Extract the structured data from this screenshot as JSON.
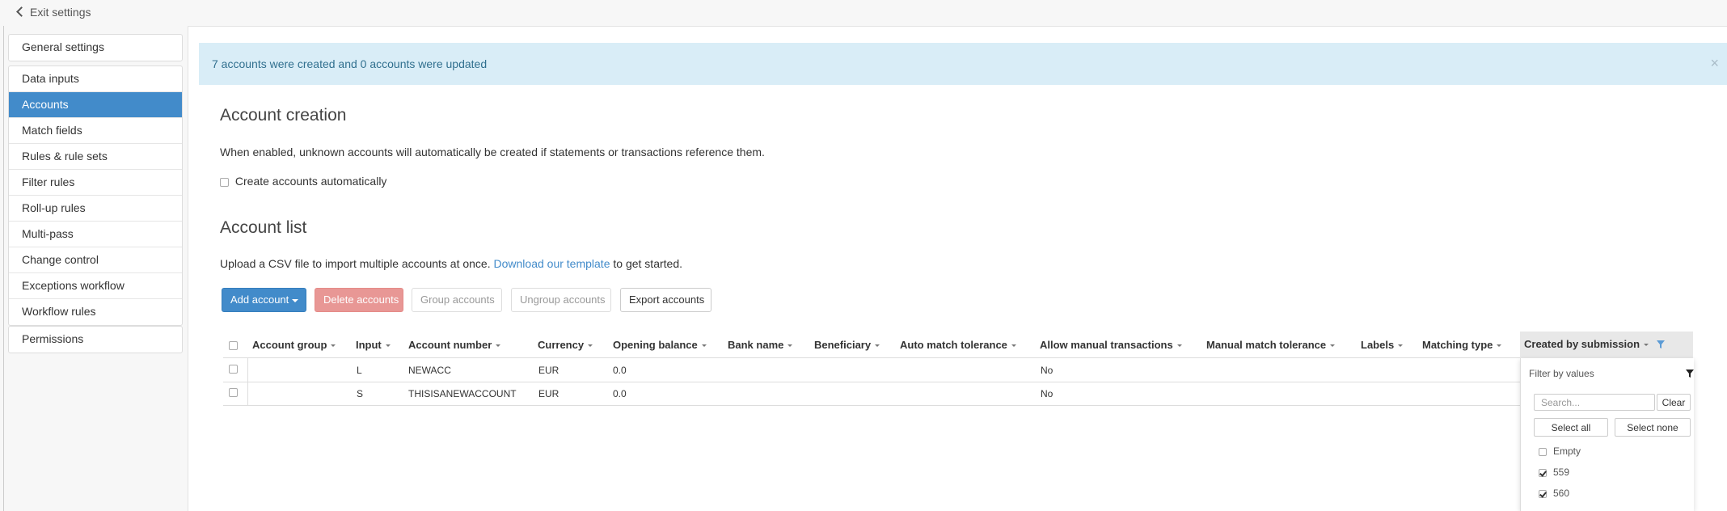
{
  "topbar": {
    "exit_label": "Exit settings"
  },
  "sidebar": {
    "group1": [
      "General settings"
    ],
    "group2": [
      "Data inputs",
      "Accounts",
      "Match fields",
      "Rules & rule sets",
      "Filter rules",
      "Roll-up rules",
      "Multi-pass",
      "Change control",
      "Exceptions workflow",
      "Workflow rules"
    ],
    "group3": [
      "Permissions"
    ],
    "active": "Accounts"
  },
  "alert": {
    "message": "7 accounts were created and 0 accounts were updated",
    "close": "×"
  },
  "account_creation": {
    "heading": "Account creation",
    "description": "When enabled, unknown accounts will automatically be created if statements or transactions reference them.",
    "checkbox_label": "Create accounts automatically"
  },
  "account_list": {
    "heading": "Account list",
    "intro_before": "Upload a CSV file to import multiple accounts at once.",
    "intro_link": "Download our template",
    "intro_after": "to get started."
  },
  "toolbar": {
    "add": "Add account",
    "delete": "Delete accounts",
    "group": "Group accounts",
    "ungroup": "Ungroup accounts",
    "export": "Export accounts"
  },
  "table": {
    "columns": [
      "Account group",
      "Input",
      "Account number",
      "Currency",
      "Opening balance",
      "Bank name",
      "Beneficiary",
      "Auto match tolerance",
      "Allow manual transactions",
      "Manual match tolerance",
      "Labels",
      "Matching type",
      "Created by submission"
    ],
    "rows": [
      {
        "account_group": "",
        "input": "L",
        "account_number": "NEWACC",
        "currency": "EUR",
        "opening_balance": "0.0",
        "allow_manual": "No"
      },
      {
        "account_group": "",
        "input": "S",
        "account_number": "THISISANEWACCOUNT",
        "currency": "EUR",
        "opening_balance": "0.0",
        "allow_manual": "No"
      }
    ]
  },
  "filter_panel": {
    "title": "Filter by values",
    "search_placeholder": "Search...",
    "clear": "Clear",
    "select_all": "Select all",
    "select_none": "Select none",
    "options": [
      {
        "label": "Empty",
        "checked": false
      },
      {
        "label": "559",
        "checked": true
      },
      {
        "label": "560",
        "checked": true
      }
    ]
  },
  "colors": {
    "primary": "#428bca",
    "danger": "#d9534f",
    "alert_bg": "#d9edf7",
    "alert_text": "#31708f"
  }
}
